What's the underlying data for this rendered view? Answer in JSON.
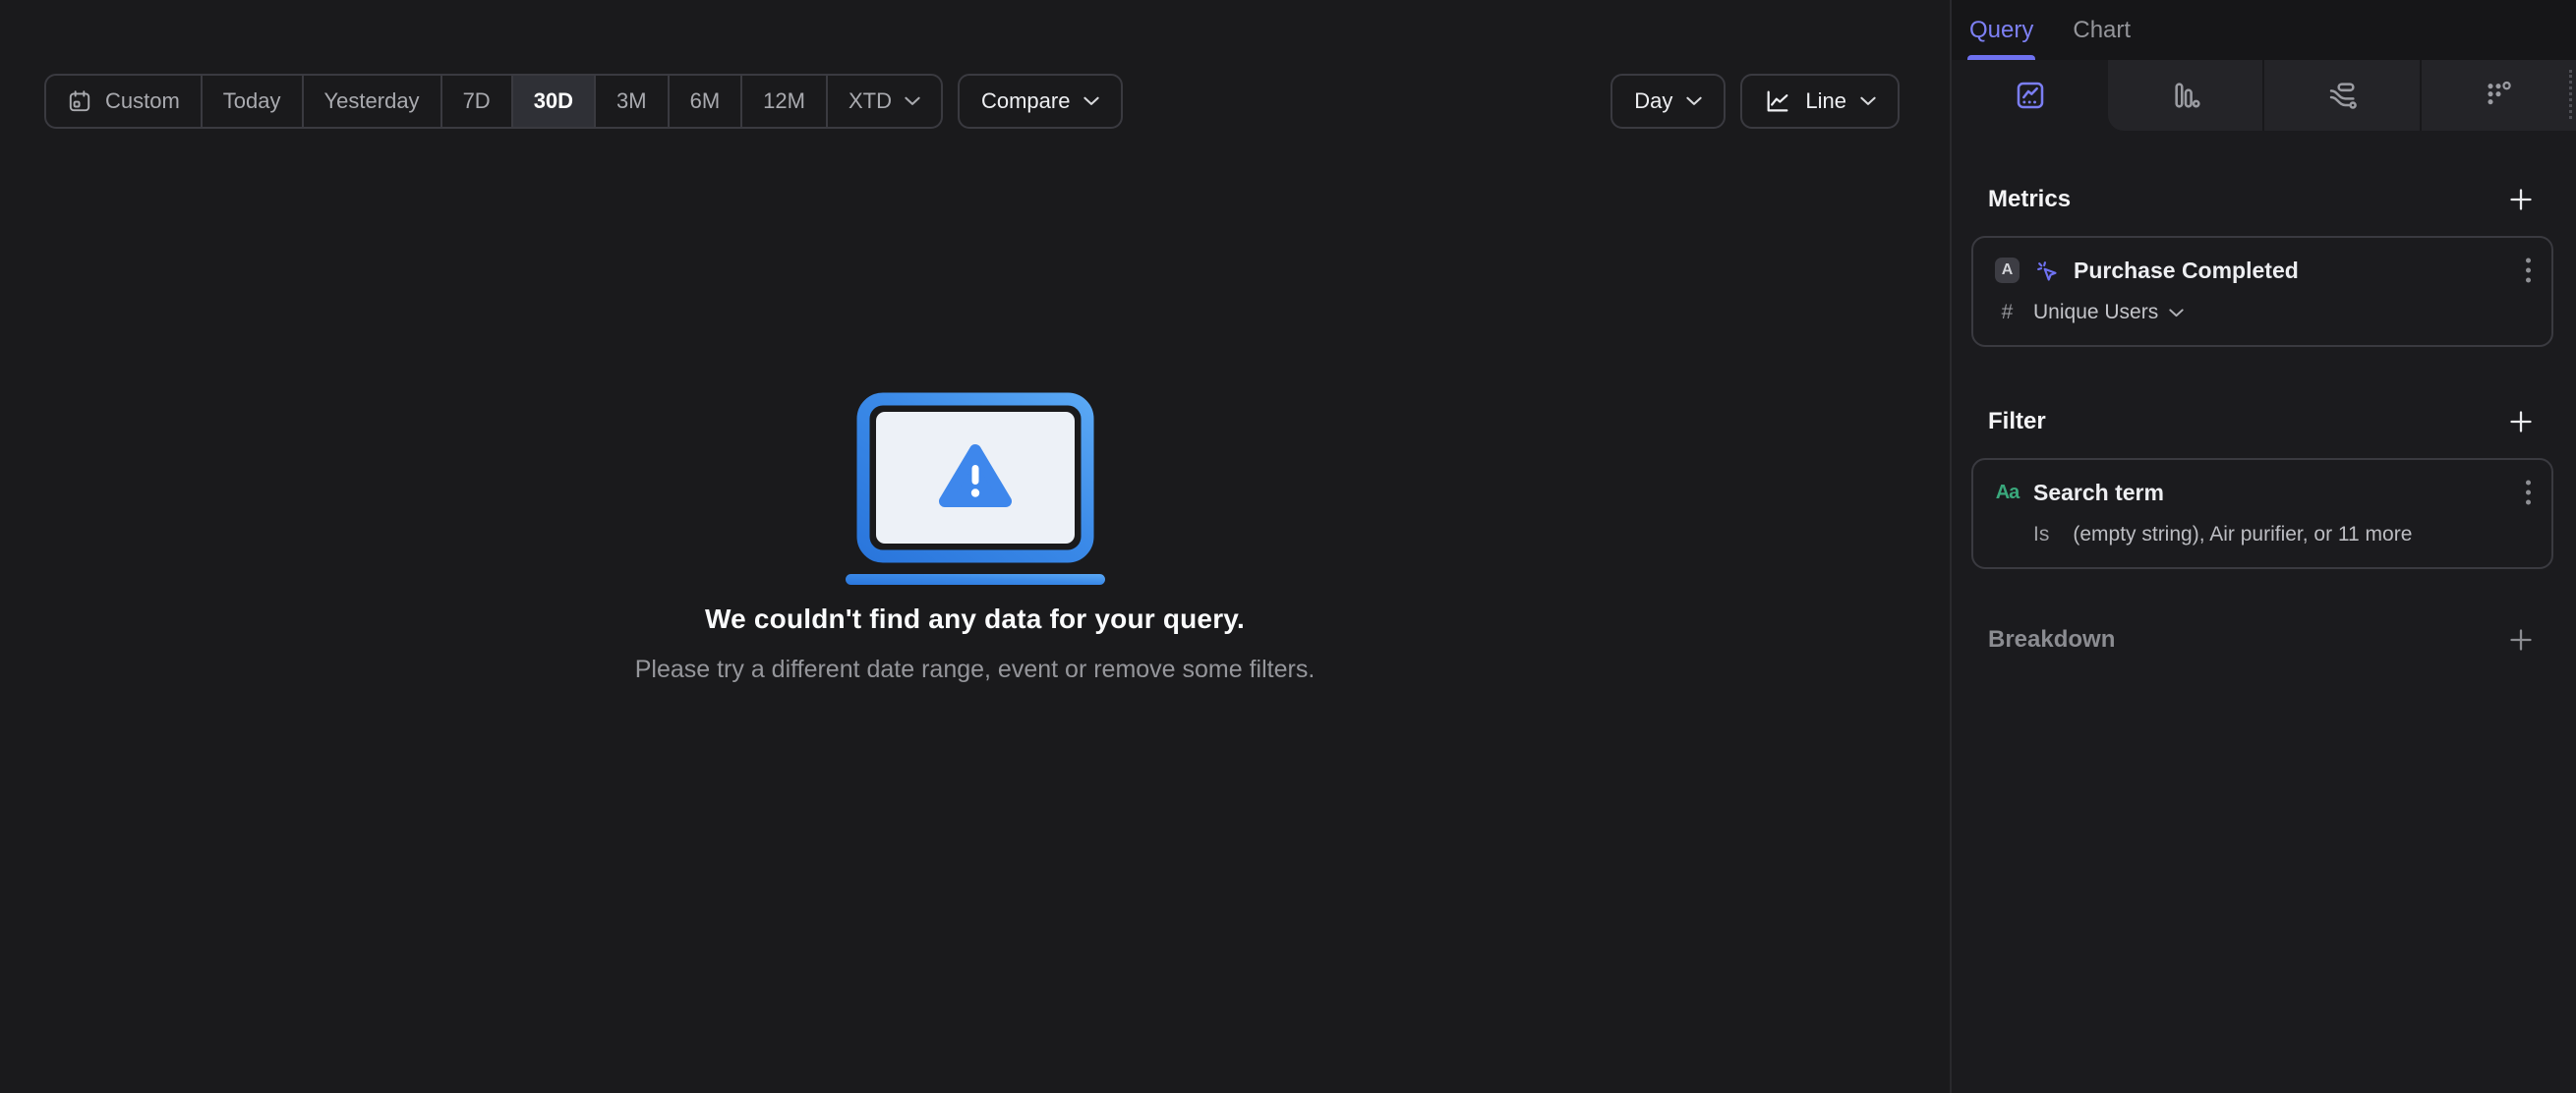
{
  "toolbar": {
    "date_ranges": [
      "Custom",
      "Today",
      "Yesterday",
      "7D",
      "30D",
      "3M",
      "6M",
      "12M",
      "XTD"
    ],
    "selected_range": "30D",
    "compare_label": "Compare",
    "granularity_label": "Day",
    "chart_type_label": "Line"
  },
  "empty_state": {
    "title": "We couldn't find any data for your query.",
    "subtitle": "Please try a different date range, event or remove some filters."
  },
  "panel": {
    "tabs": [
      "Query",
      "Chart"
    ],
    "active_tab": "Query",
    "metrics": {
      "title": "Metrics",
      "event_badge": "A",
      "event_name": "Purchase Completed",
      "aggregation_symbol": "#",
      "aggregation_label": "Unique Users"
    },
    "filter": {
      "title": "Filter",
      "property_type_glyph": "Aa",
      "property_name": "Search term",
      "operator": "Is",
      "values_summary": "(empty string), Air purifier, or 11 more"
    },
    "breakdown": {
      "title": "Breakdown"
    }
  },
  "colors": {
    "background": "#1a1a1c",
    "accent_purple": "#6e71f0",
    "accent_green": "#3aa87c",
    "empty_state_blue_dark": "#2a76dc",
    "empty_state_blue_light": "#5aa8f4",
    "warning_triangle_blue": "#3e87ec",
    "selected_segment_bg": "#2f3036"
  }
}
